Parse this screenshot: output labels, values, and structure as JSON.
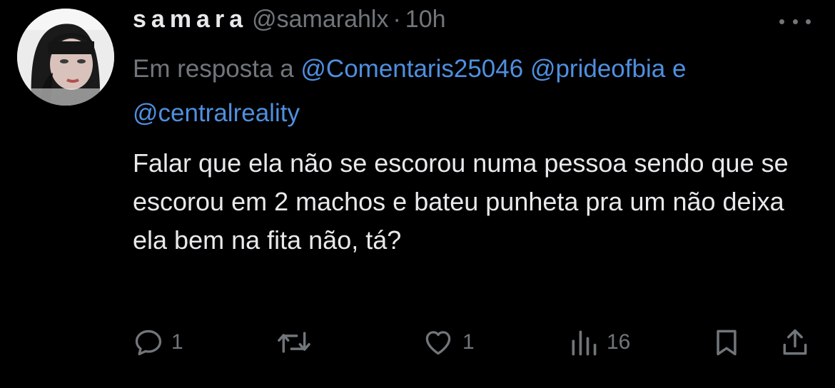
{
  "user": {
    "name": "samara",
    "handle": "@samarahlx",
    "separator": "·",
    "time": "10h"
  },
  "reply_context": {
    "prefix": "Em resposta a",
    "mention1": "@Comentaris25046",
    "mention2": "@prideofbia",
    "conjunction": "e",
    "mention3": "@centralreality"
  },
  "tweet": {
    "text": "Falar que ela não se escorou numa pessoa sendo que se escorou em 2 machos e bateu punheta pra um não deixa ela bem na fita não, tá?"
  },
  "actions": {
    "reply_count": "1",
    "like_count": "1",
    "views_count": "16"
  },
  "icons": [
    "more-icon",
    "reply-icon",
    "retweet-icon",
    "like-icon",
    "views-icon",
    "bookmark-icon",
    "share-icon"
  ],
  "colors": {
    "background": "#000000",
    "text": "#e7e9ea",
    "muted": "#71767b",
    "link": "#4f8fdf"
  }
}
